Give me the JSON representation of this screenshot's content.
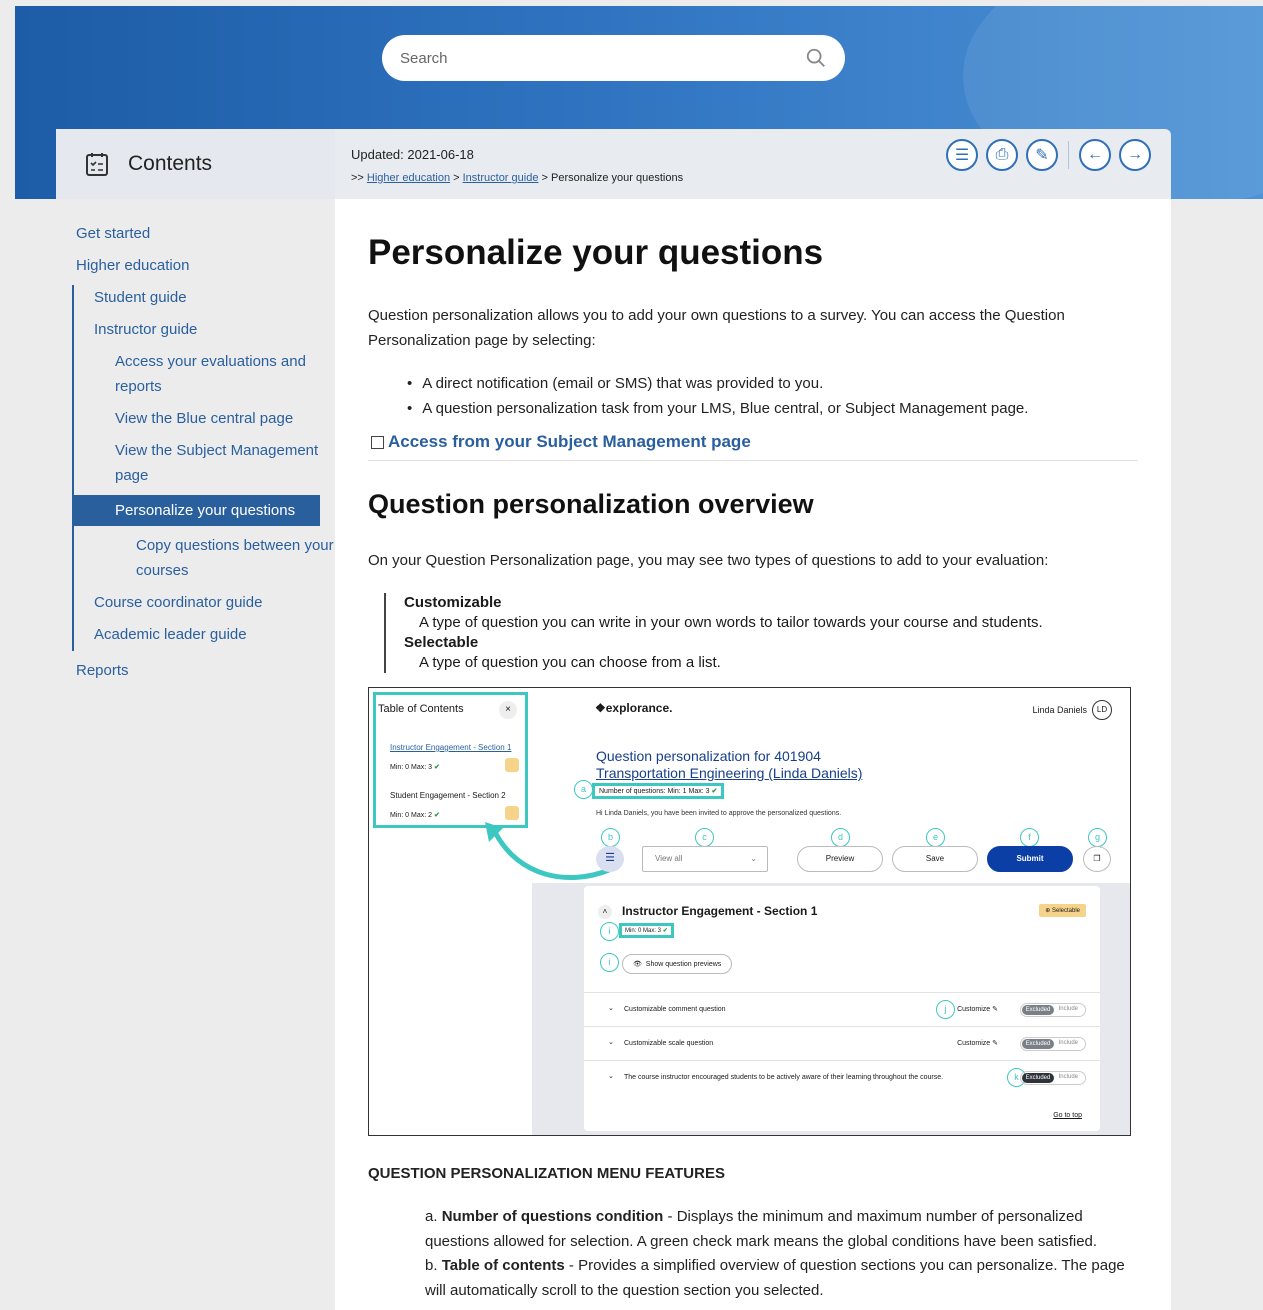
{
  "search": {
    "placeholder": "Search"
  },
  "sidebar": {
    "title": "Contents",
    "items": [
      {
        "label": "Get started"
      },
      {
        "label": "Higher education"
      },
      {
        "label": "Student guide"
      },
      {
        "label": "Instructor guide"
      },
      {
        "label": "Access your evaluations and reports"
      },
      {
        "label": "View the Blue central page"
      },
      {
        "label": "View the Subject Management page"
      },
      {
        "label": "Personalize your questions"
      },
      {
        "label": "Copy questions between your courses"
      },
      {
        "label": "Course coordinator guide"
      },
      {
        "label": "Academic leader guide"
      },
      {
        "label": "Reports"
      }
    ]
  },
  "topbar": {
    "updated": "Updated: 2021-06-18",
    "crumb_prefix": ">> ",
    "crumb1": "Higher education",
    "crumb_sep": " > ",
    "crumb2": "Instructor guide",
    "crumb_current": " > Personalize your questions"
  },
  "main": {
    "title": "Personalize your questions",
    "intro": "Question personalization allows you to add your own questions to a survey. You can access the Question Personalization page by selecting:",
    "bullets": [
      "A direct notification (email or SMS) that was provided to you.",
      "A question personalization task from your LMS, Blue central, or Subject Management page."
    ],
    "expander": "Access from your Subject Management page",
    "h2": "Question personalization overview",
    "p2": "On your Question Personalization page, you may see two types of questions to add to your evaluation:",
    "terms": [
      {
        "t": "Customizable",
        "d": "A type of question you can write in your own words to tailor towards your course and students."
      },
      {
        "t": "Selectable",
        "d": "A type of question you can choose from a list."
      }
    ],
    "h3": "QUESTION PERSONALIZATION MENU FEATURES",
    "features": [
      {
        "k": "a. ",
        "t": "Number of questions condition",
        "d": " - Displays the minimum and maximum number of personalized questions allowed for selection. A green check mark means the global conditions have been satisfied."
      },
      {
        "k": "b. ",
        "t": "Table of contents",
        "d": " - Provides a simplified overview of question sections you can personalize. The page will automatically scroll to the question section you selected."
      }
    ]
  },
  "shot": {
    "toc_title": "Table of Contents",
    "toc_close": "×",
    "toc_e1": "Instructor Engagement - Section 1",
    "toc_m1": "Min: 0   Max: 3",
    "toc_e2": "Student Engagement - Section 2",
    "toc_m2": "Min: 0   Max: 2",
    "logo": "❖explorance.",
    "user": "Linda Daniels",
    "initials": "LD",
    "qtitle1": "Question personalization for 401904",
    "qtitle2": "Transportation Engineering (Linda Daniels)",
    "nq": "Number of questions:   Min: 1   Max: 3",
    "hi": "Hi Linda Daniels, you have been invited to approve the personalized questions.",
    "viewall": "View all",
    "preview": "Preview",
    "save": "Save",
    "submit": "Submit",
    "card_title": "Instructor Engagement - Section 1",
    "badge": "⊕ Selectable",
    "mm": "Min: 0   Max: 3",
    "showprev": "Show question previews",
    "rows": [
      "Customizable comment question",
      "Customizable scale question",
      "The course instructor encouraged students to be actively aware of their learning throughout the course."
    ],
    "customize": "Customize",
    "excluded": "Excluded",
    "include": "Include",
    "goto": "Go to top",
    "labels": [
      "a",
      "b",
      "c",
      "d",
      "e",
      "f",
      "g",
      "i",
      "i",
      "j",
      "k"
    ],
    "check": "✔"
  },
  "colors": {
    "accent": "#2a5f9e",
    "teal": "#3cc8c0",
    "submit": "#0b3fa6"
  }
}
